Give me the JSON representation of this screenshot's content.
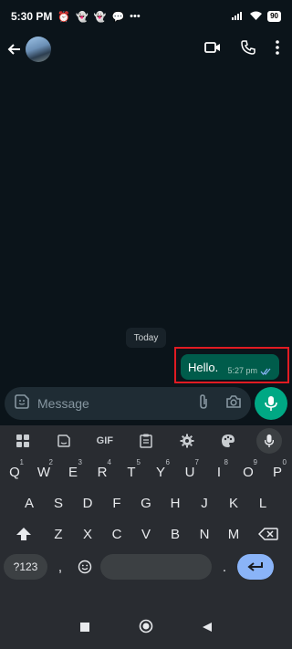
{
  "status": {
    "time": "5:30 PM",
    "battery": "90"
  },
  "chat": {
    "date_chip": "Today",
    "message": {
      "text": "Hello.",
      "time": "5:27 pm"
    }
  },
  "composer": {
    "placeholder": "Message"
  },
  "keyboard": {
    "toolbar_gif": "GIF",
    "row1": [
      {
        "k": "Q",
        "n": "1"
      },
      {
        "k": "W",
        "n": "2"
      },
      {
        "k": "E",
        "n": "3"
      },
      {
        "k": "R",
        "n": "4"
      },
      {
        "k": "T",
        "n": "5"
      },
      {
        "k": "Y",
        "n": "6"
      },
      {
        "k": "U",
        "n": "7"
      },
      {
        "k": "I",
        "n": "8"
      },
      {
        "k": "O",
        "n": "9"
      },
      {
        "k": "P",
        "n": "0"
      }
    ],
    "row2": [
      "A",
      "S",
      "D",
      "F",
      "G",
      "H",
      "J",
      "K",
      "L"
    ],
    "row3": [
      "Z",
      "X",
      "C",
      "V",
      "B",
      "N",
      "M"
    ],
    "symbols": "?123",
    "comma": ",",
    "period": "."
  }
}
